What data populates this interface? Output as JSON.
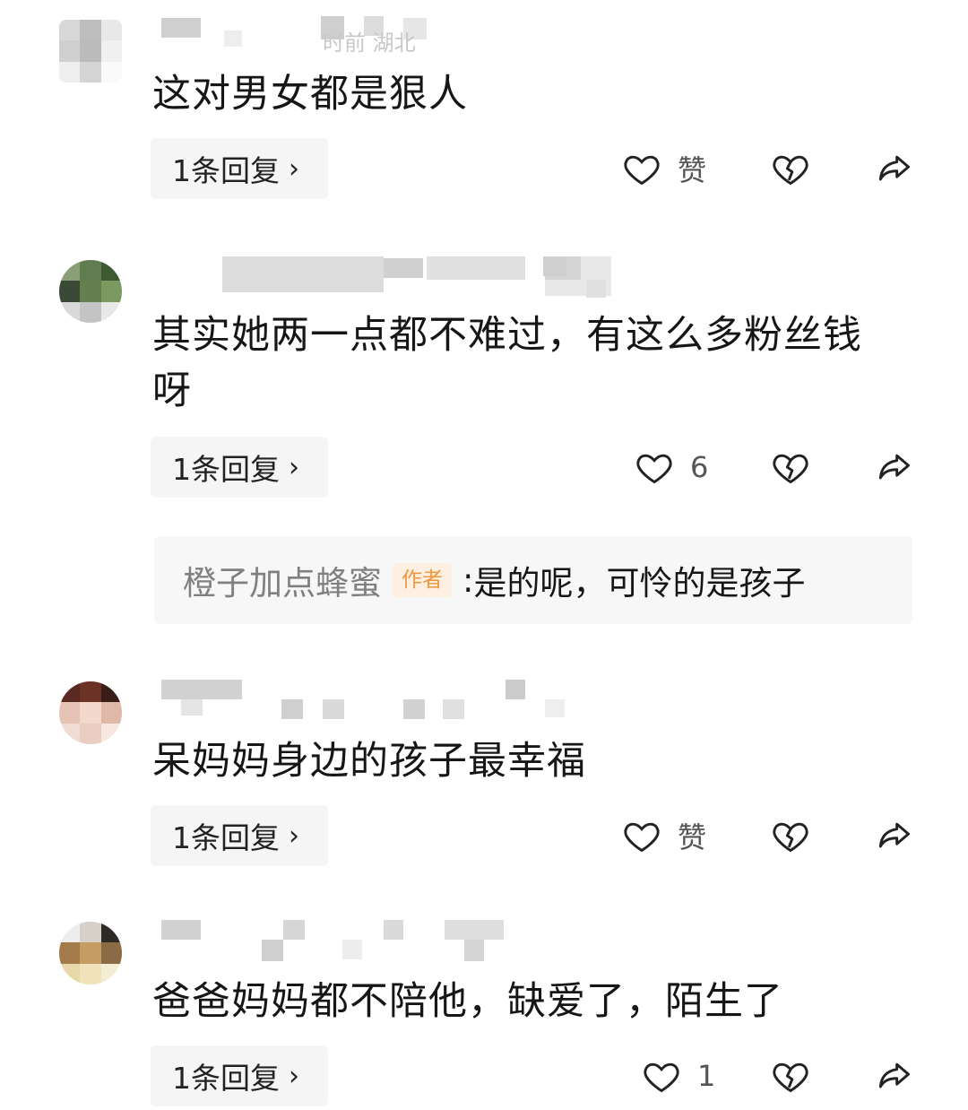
{
  "comments": [
    {
      "meta_text": "时前 湖北",
      "text": "这对男女都是狠人",
      "reply_label": "1条回复",
      "like_label": "赞"
    },
    {
      "text": "其实她两一点都不难过，有这么多粉丝钱呀",
      "reply_label": "1条回复",
      "like_label": "6",
      "author_reply": {
        "name": "橙子加点蜂蜜",
        "badge": "作者",
        "separator": ":",
        "text": "是的呢，可怜的是孩子"
      }
    },
    {
      "text": "呆妈妈身边的孩子最幸福",
      "reply_label": "1条回复",
      "like_label": "赞"
    },
    {
      "text": "爸爸妈妈都不陪他，缺爱了，陌生了",
      "reply_label": "1条回复",
      "like_label": "1"
    }
  ],
  "icons": {
    "like": "heart-outline-icon",
    "dislike": "broken-heart-icon",
    "share": "share-arrow-icon",
    "chevron": "chevron-right-icon"
  },
  "colors": {
    "text": "#161616",
    "secondary": "#808080",
    "reply_bg": "#f5f5f5",
    "author_badge": "#f0963c"
  }
}
